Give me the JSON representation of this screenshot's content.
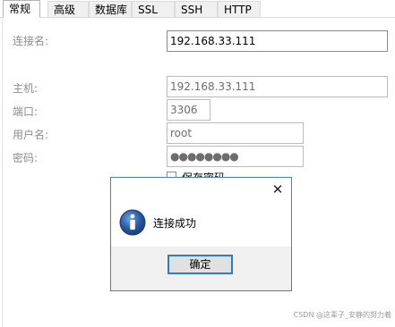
{
  "tabs": [
    "常规",
    "高级",
    "数据库",
    "SSL",
    "SSH",
    "HTTP"
  ],
  "form": {
    "connection_name": {
      "label": "连接名:",
      "value": "192.168.33.111"
    },
    "host": {
      "label": "主机:",
      "value": "192.168.33.111"
    },
    "port": {
      "label": "端口:",
      "value": "3306"
    },
    "username": {
      "label": "用户名:",
      "value": "root"
    },
    "password": {
      "label": "密码:",
      "value": "●●●●●●●●"
    },
    "save_password_label": "保存密码"
  },
  "dialog": {
    "close_glyph": "✕",
    "message": "连接成功",
    "ok_label": "确定",
    "icon": "info-icon"
  },
  "watermark": "CSDN @这辈子_安静的努力着",
  "colors": {
    "dialog_border": "#3c84c3",
    "ok_focus": "#2f7ad1",
    "info_icon": "#2a5aa8"
  }
}
